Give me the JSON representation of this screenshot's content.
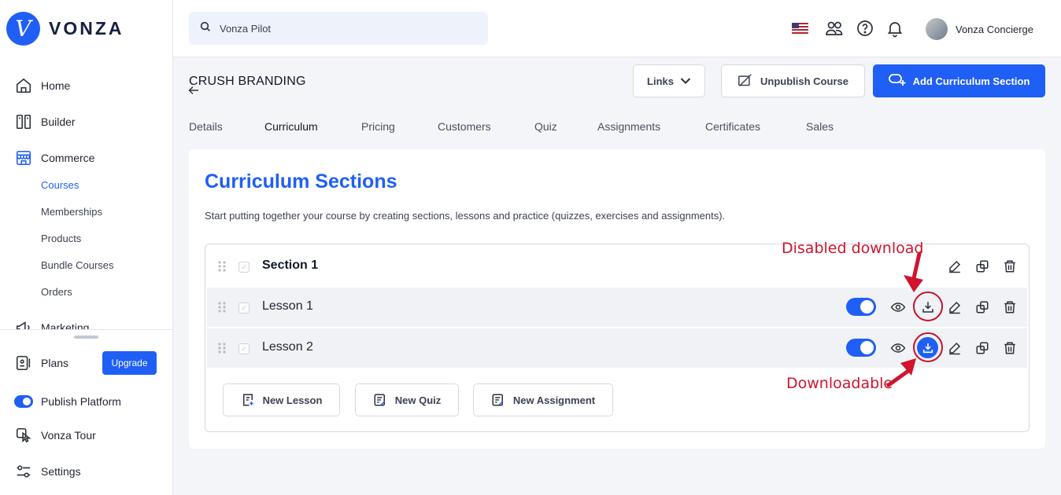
{
  "brand": {
    "name": "VONZA",
    "mark": "V"
  },
  "sidebar": {
    "items": [
      {
        "label": "Home"
      },
      {
        "label": "Builder"
      },
      {
        "label": "Commerce"
      },
      {
        "label": "Marketing"
      }
    ],
    "commerce_sub": [
      {
        "label": "Courses",
        "active": true
      },
      {
        "label": "Memberships"
      },
      {
        "label": "Products"
      },
      {
        "label": "Bundle Courses"
      },
      {
        "label": "Orders"
      }
    ],
    "bottom": {
      "plans": "Plans",
      "upgrade": "Upgrade",
      "publish": "Publish Platform",
      "tour": "Vonza Tour",
      "settings": "Settings"
    }
  },
  "topbar": {
    "search_placeholder": "Vonza Pilot",
    "user_name": "Vonza Concierge"
  },
  "course": {
    "title": "CRUSH BRANDING",
    "links_label": "Links",
    "unpublish_label": "Unpublish Course",
    "add_section_label": "Add Curriculum Section"
  },
  "tabs": [
    "Details",
    "Curriculum",
    "Pricing",
    "Customers",
    "Quiz",
    "Assignments",
    "Certificates",
    "Sales"
  ],
  "active_tab": "Curriculum",
  "curriculum": {
    "heading": "Curriculum Sections",
    "description": "Start putting together your course by creating sections, lessons and practice (quizzes, exercises and assignments).",
    "section": {
      "label": "Section 1"
    },
    "lessons": [
      {
        "label": "Lesson 1",
        "published": true,
        "downloadable": false
      },
      {
        "label": "Lesson 2",
        "published": true,
        "downloadable": true
      }
    ],
    "buttons": {
      "new_lesson": "New Lesson",
      "new_quiz": "New Quiz",
      "new_assignment": "New Assignment"
    }
  },
  "annotations": {
    "disabled": "Disabled download",
    "downloadable": "Downloadable",
    "color": "#d0142c"
  },
  "colors": {
    "primary": "#1f5ff5"
  }
}
